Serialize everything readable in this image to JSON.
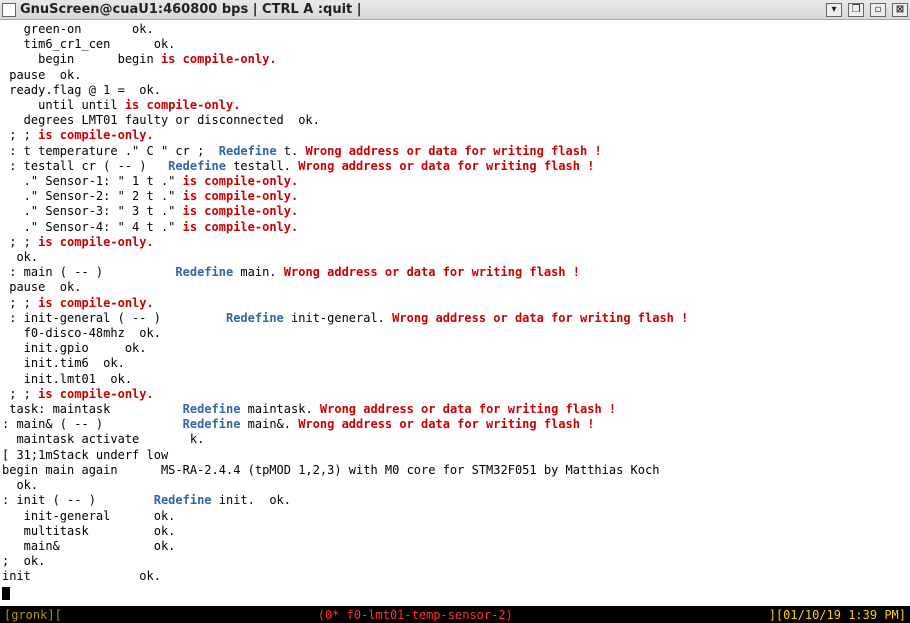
{
  "title": "GnuScreen@cuaU1:460800 bps | CTRL A :quit |",
  "winbtns": {
    "min": "▾",
    "restore": "❐",
    "max": "▫",
    "close": "⊠"
  },
  "lines": [
    [
      [
        "   green-on       ok."
      ]
    ],
    [
      [
        "   tim6_cr1_cen      ok."
      ]
    ],
    [
      [
        "     begin      begin "
      ],
      [
        "r",
        "is compile-only."
      ]
    ],
    [
      [
        " pause  ok."
      ]
    ],
    [
      [
        " ready.flag @ 1 =  ok."
      ]
    ],
    [
      [
        "     until until "
      ],
      [
        "r",
        "is compile-only."
      ]
    ],
    [
      [
        "   degrees LMT01 faulty or disconnected  ok."
      ]
    ],
    [
      [
        " ; ; "
      ],
      [
        "r",
        "is compile-only."
      ]
    ],
    [
      [
        " : t temperature .\" C \" cr ;  "
      ],
      [
        "b",
        "Redefine"
      ],
      [
        " t. "
      ],
      [
        "r",
        "Wrong address or data for writing flash !"
      ]
    ],
    [
      [
        " : testall cr ( -- )   "
      ],
      [
        "b",
        "Redefine"
      ],
      [
        " testall. "
      ],
      [
        "r",
        "Wrong address or data for writing flash !"
      ]
    ],
    [
      [
        "   .\" Sensor-1: \" 1 t .\" "
      ],
      [
        "r",
        "is compile-only."
      ]
    ],
    [
      [
        "   .\" Sensor-2: \" 2 t .\" "
      ],
      [
        "r",
        "is compile-only."
      ]
    ],
    [
      [
        "   .\" Sensor-3: \" 3 t .\" "
      ],
      [
        "r",
        "is compile-only."
      ]
    ],
    [
      [
        "   .\" Sensor-4: \" 4 t .\" "
      ],
      [
        "r",
        "is compile-only."
      ]
    ],
    [
      [
        " ; ; "
      ],
      [
        "r",
        "is compile-only."
      ]
    ],
    [
      [
        "  ok."
      ]
    ],
    [
      [
        " : main ( -- )          "
      ],
      [
        "b",
        "Redefine"
      ],
      [
        " main. "
      ],
      [
        "r",
        "Wrong address or data for writing flash !"
      ]
    ],
    [
      [
        " pause  ok."
      ]
    ],
    [
      [
        " ; ; "
      ],
      [
        "r",
        "is compile-only."
      ]
    ],
    [
      [
        " : init-general ( -- )         "
      ],
      [
        "b",
        "Redefine"
      ],
      [
        " init-general. "
      ],
      [
        "r",
        "Wrong address or data for writing flash !"
      ]
    ],
    [
      [
        "   f0-disco-48mhz  ok."
      ]
    ],
    [
      [
        "   init.gpio     ok."
      ]
    ],
    [
      [
        "   init.tim6  ok."
      ]
    ],
    [
      [
        "   init.lmt01  ok."
      ]
    ],
    [
      [
        " ; ; "
      ],
      [
        "r",
        "is compile-only."
      ]
    ],
    [
      [
        " task: maintask          "
      ],
      [
        "b",
        "Redefine"
      ],
      [
        " maintask. "
      ],
      [
        "r",
        "Wrong address or data for writing flash !"
      ]
    ],
    [
      [
        ": main& ( -- )           "
      ],
      [
        "b",
        "Redefine"
      ],
      [
        " main&. "
      ],
      [
        "r",
        "Wrong address or data for writing flash !"
      ]
    ],
    [
      [
        "  maintask activate       k."
      ]
    ],
    [
      [
        "[ 31;1mStack underf low"
      ]
    ],
    [
      [
        "begin main again      MS-RA-2.4.4 (tpMOD 1,2,3) with M0 core for STM32F051 by Matthias Koch"
      ]
    ],
    [
      [
        "  ok."
      ]
    ],
    [
      [
        ": init ( -- )        "
      ],
      [
        "b",
        "Redefine"
      ],
      [
        " init.  ok."
      ]
    ],
    [
      [
        "   init-general      ok."
      ]
    ],
    [
      [
        "   multitask         ok."
      ]
    ],
    [
      [
        "   main&             ok."
      ]
    ],
    [
      [
        ";  ok."
      ]
    ],
    [
      [
        "init               ok."
      ]
    ]
  ],
  "statbar": {
    "left": "[gronk][",
    "mid_open": "(",
    "mid": "0* f0-lmt01-temp-sensor-2",
    "mid_close": ")",
    "right": "][01/10/19  1:39 PM]"
  }
}
